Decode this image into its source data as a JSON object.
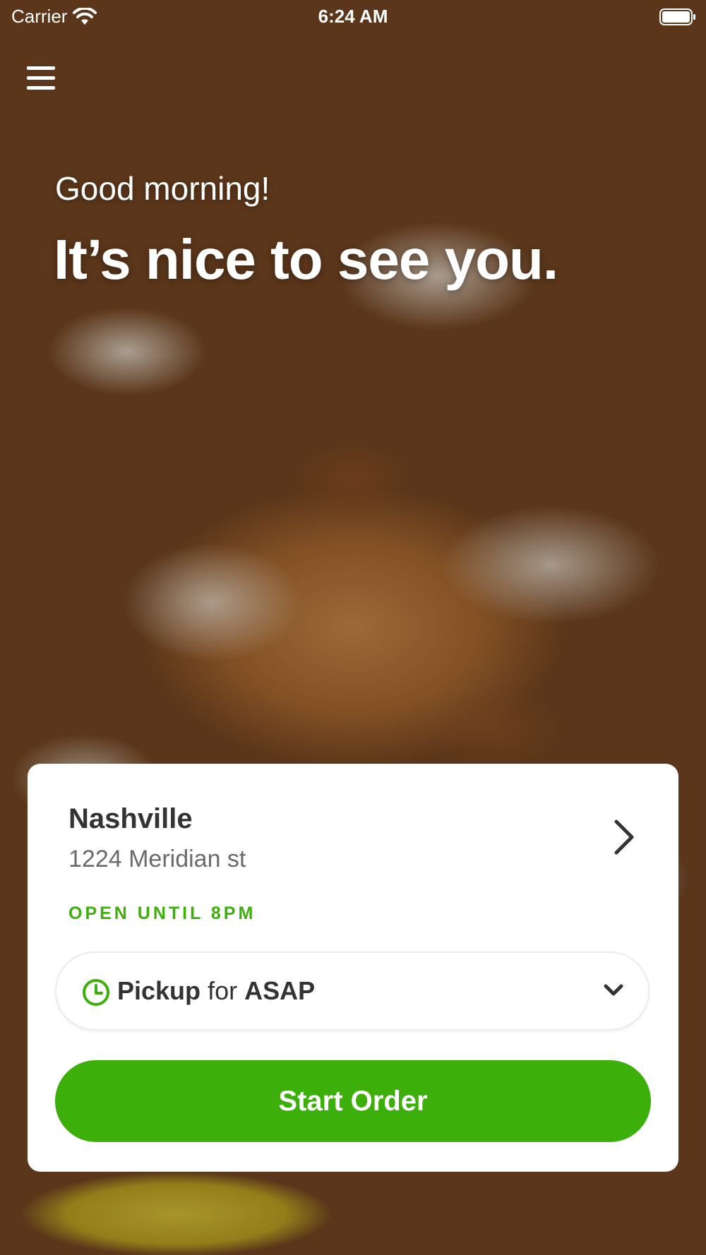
{
  "status_bar": {
    "carrier": "Carrier",
    "time": "6:24 AM"
  },
  "hero": {
    "greeting": "Good morning!",
    "headline": "It’s nice to see you."
  },
  "location": {
    "name": "Nashville",
    "address": "1224 Meridian st",
    "status": "OPEN UNTIL 8PM"
  },
  "order_mode": {
    "mode": "Pickup",
    "connector": "for",
    "time": "ASAP"
  },
  "actions": {
    "start_order": "Start Order"
  },
  "colors": {
    "accent": "#3caf0a",
    "card": "#ffffff",
    "text_dark": "#333333",
    "text_muted": "#6a6a6a"
  },
  "icons": [
    "wifi-icon",
    "battery-icon",
    "menu-icon",
    "chevron-right-icon",
    "clock-icon",
    "chevron-down-icon"
  ]
}
